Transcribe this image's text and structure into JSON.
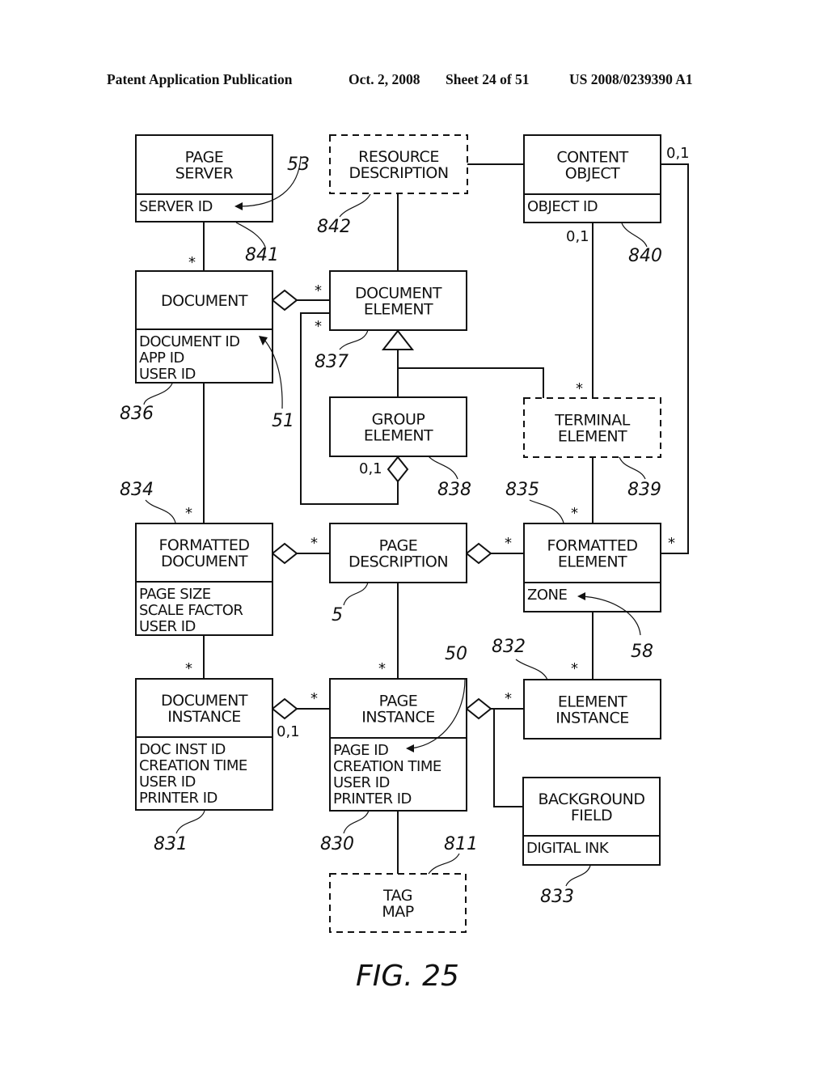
{
  "header": {
    "publication": "Patent Application Publication",
    "date": "Oct. 2, 2008",
    "sheet": "Sheet 24 of 51",
    "number": "US 2008/0239390 A1"
  },
  "figure_label": "FIG. 25",
  "classes": {
    "page_server": {
      "name": [
        "PAGE",
        "SERVER"
      ],
      "attrs": [
        "SERVER ID"
      ],
      "ref": "841",
      "style": "solid"
    },
    "resource_description": {
      "name": [
        "RESOURCE",
        "DESCRIPTION"
      ],
      "attrs": [],
      "ref": "842",
      "style": "dashed"
    },
    "content_object": {
      "name": [
        "CONTENT",
        "OBJECT"
      ],
      "attrs": [
        "OBJECT ID"
      ],
      "ref": "840",
      "style": "solid"
    },
    "document": {
      "name": [
        "DOCUMENT"
      ],
      "attrs": [
        "DOCUMENT ID",
        "APP ID",
        "USER ID"
      ],
      "ref": "836",
      "style": "solid"
    },
    "document_element": {
      "name": [
        "DOCUMENT",
        "ELEMENT"
      ],
      "attrs": [],
      "ref": "837",
      "style": "solid"
    },
    "group_element": {
      "name": [
        "GROUP",
        "ELEMENT"
      ],
      "attrs": [],
      "ref": "838",
      "style": "solid"
    },
    "terminal_element": {
      "name": [
        "TERMINAL",
        "ELEMENT"
      ],
      "attrs": [],
      "ref": "839",
      "style": "dashed"
    },
    "formatted_document": {
      "name": [
        "FORMATTED",
        "DOCUMENT"
      ],
      "attrs": [
        "PAGE SIZE",
        "SCALE FACTOR",
        "USER ID"
      ],
      "ref": "834",
      "style": "solid"
    },
    "page_description": {
      "name": [
        "PAGE",
        "DESCRIPTION"
      ],
      "attrs": [],
      "ref": "5",
      "style": "solid"
    },
    "formatted_element": {
      "name": [
        "FORMATTED",
        "ELEMENT"
      ],
      "attrs": [
        "ZONE"
      ],
      "ref": "835",
      "style": "solid"
    },
    "document_instance": {
      "name": [
        "DOCUMENT",
        "INSTANCE"
      ],
      "attrs": [
        "DOC INST ID",
        "CREATION TIME",
        "USER ID",
        "PRINTER ID"
      ],
      "ref": "831",
      "style": "solid"
    },
    "page_instance": {
      "name": [
        "PAGE",
        "INSTANCE"
      ],
      "attrs": [
        "PAGE ID",
        "CREATION TIME",
        "USER ID",
        "PRINTER ID"
      ],
      "ref": "830",
      "style": "solid"
    },
    "element_instance": {
      "name": [
        "ELEMENT",
        "INSTANCE"
      ],
      "attrs": [],
      "ref": "832",
      "style": "solid"
    },
    "background_field": {
      "name": [
        "BACKGROUND",
        "FIELD"
      ],
      "attrs": [
        "DIGITAL INK"
      ],
      "ref": "833",
      "style": "solid"
    },
    "tag_map": {
      "name": [
        "TAG",
        "MAP"
      ],
      "attrs": [],
      "ref": "811",
      "style": "dashed"
    }
  },
  "attribute_refs": {
    "server_id": "53",
    "document_id": "51",
    "zone": "58",
    "page_id": "50"
  },
  "multiplicities": {
    "many": "*",
    "zero_or_one": "0,1"
  },
  "relationships": [
    {
      "from": "page_server",
      "to": "document",
      "to_mult": "*"
    },
    {
      "from": "resource_description",
      "to": "content_object"
    },
    {
      "from": "resource_description",
      "to": "document_element"
    },
    {
      "from": "document",
      "to": "document_element",
      "type": "aggregation",
      "to_mult": "*"
    },
    {
      "from": "content_object",
      "to": "terminal_element",
      "from_mult": "0,1",
      "to_mult": "*"
    },
    {
      "from": "content_object",
      "to": "formatted_element",
      "from_mult": "0,1",
      "to_mult": "*"
    },
    {
      "from": "group_element",
      "to": "document_element",
      "type": "generalization"
    },
    {
      "from": "terminal_element",
      "to": "document_element",
      "type": "generalization"
    },
    {
      "from": "group_element",
      "to": "document_element",
      "type": "aggregation",
      "from_mult": "0,1",
      "to_mult": "*"
    },
    {
      "from": "document",
      "to": "formatted_document",
      "to_mult": "*"
    },
    {
      "from": "formatted_document",
      "to": "page_description",
      "type": "aggregation",
      "to_mult": "*"
    },
    {
      "from": "page_description",
      "to": "formatted_element",
      "type": "aggregation",
      "to_mult": "*"
    },
    {
      "from": "terminal_element",
      "to": "formatted_element",
      "to_mult": "*"
    },
    {
      "from": "formatted_document",
      "to": "document_instance",
      "to_mult": "*"
    },
    {
      "from": "page_description",
      "to": "page_instance",
      "to_mult": "*"
    },
    {
      "from": "formatted_element",
      "to": "element_instance",
      "to_mult": "*"
    },
    {
      "from": "document_instance",
      "to": "page_instance",
      "type": "aggregation",
      "from_mult": "0,1",
      "to_mult": "*"
    },
    {
      "from": "page_instance",
      "to": "element_instance",
      "type": "aggregation",
      "to_mult": "*"
    },
    {
      "from": "page_instance",
      "to": "background_field",
      "type": "aggregation"
    },
    {
      "from": "page_instance",
      "to": "tag_map"
    }
  ]
}
